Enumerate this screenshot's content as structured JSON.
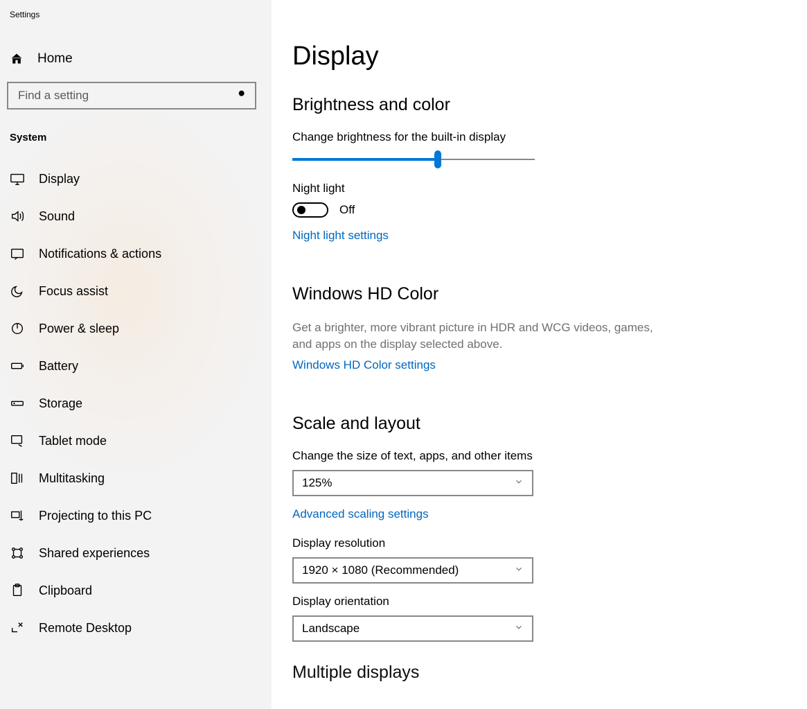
{
  "window": {
    "title": "Settings"
  },
  "sidebar": {
    "home_label": "Home",
    "search_placeholder": "Find a setting",
    "section_header": "System",
    "items": [
      {
        "label": "Display",
        "icon": "monitor-icon"
      },
      {
        "label": "Sound",
        "icon": "speaker-icon"
      },
      {
        "label": "Notifications & actions",
        "icon": "notification-icon"
      },
      {
        "label": "Focus assist",
        "icon": "moon-icon"
      },
      {
        "label": "Power & sleep",
        "icon": "power-icon"
      },
      {
        "label": "Battery",
        "icon": "battery-icon"
      },
      {
        "label": "Storage",
        "icon": "storage-icon"
      },
      {
        "label": "Tablet mode",
        "icon": "tablet-icon"
      },
      {
        "label": "Multitasking",
        "icon": "multitask-icon"
      },
      {
        "label": "Projecting to this PC",
        "icon": "project-icon"
      },
      {
        "label": "Shared experiences",
        "icon": "share-icon"
      },
      {
        "label": "Clipboard",
        "icon": "clipboard-icon"
      },
      {
        "label": "Remote Desktop",
        "icon": "remote-icon"
      }
    ]
  },
  "main": {
    "page_title": "Display",
    "brightness": {
      "heading": "Brightness and color",
      "label": "Change brightness for the built-in display",
      "slider_percent": 60,
      "night_light_label": "Night light",
      "night_light_state": "Off",
      "night_light_settings_link": "Night light settings"
    },
    "hdcolor": {
      "heading": "Windows HD Color",
      "description": "Get a brighter, more vibrant picture in HDR and WCG videos, games, and apps on the display selected above.",
      "link": "Windows HD Color settings"
    },
    "scale": {
      "heading": "Scale and layout",
      "size_label": "Change the size of text, apps, and other items",
      "size_value": "125%",
      "advanced_link": "Advanced scaling settings",
      "resolution_label": "Display resolution",
      "resolution_value": "1920 × 1080 (Recommended)",
      "orientation_label": "Display orientation",
      "orientation_value": "Landscape"
    },
    "multiple_heading": "Multiple displays"
  }
}
